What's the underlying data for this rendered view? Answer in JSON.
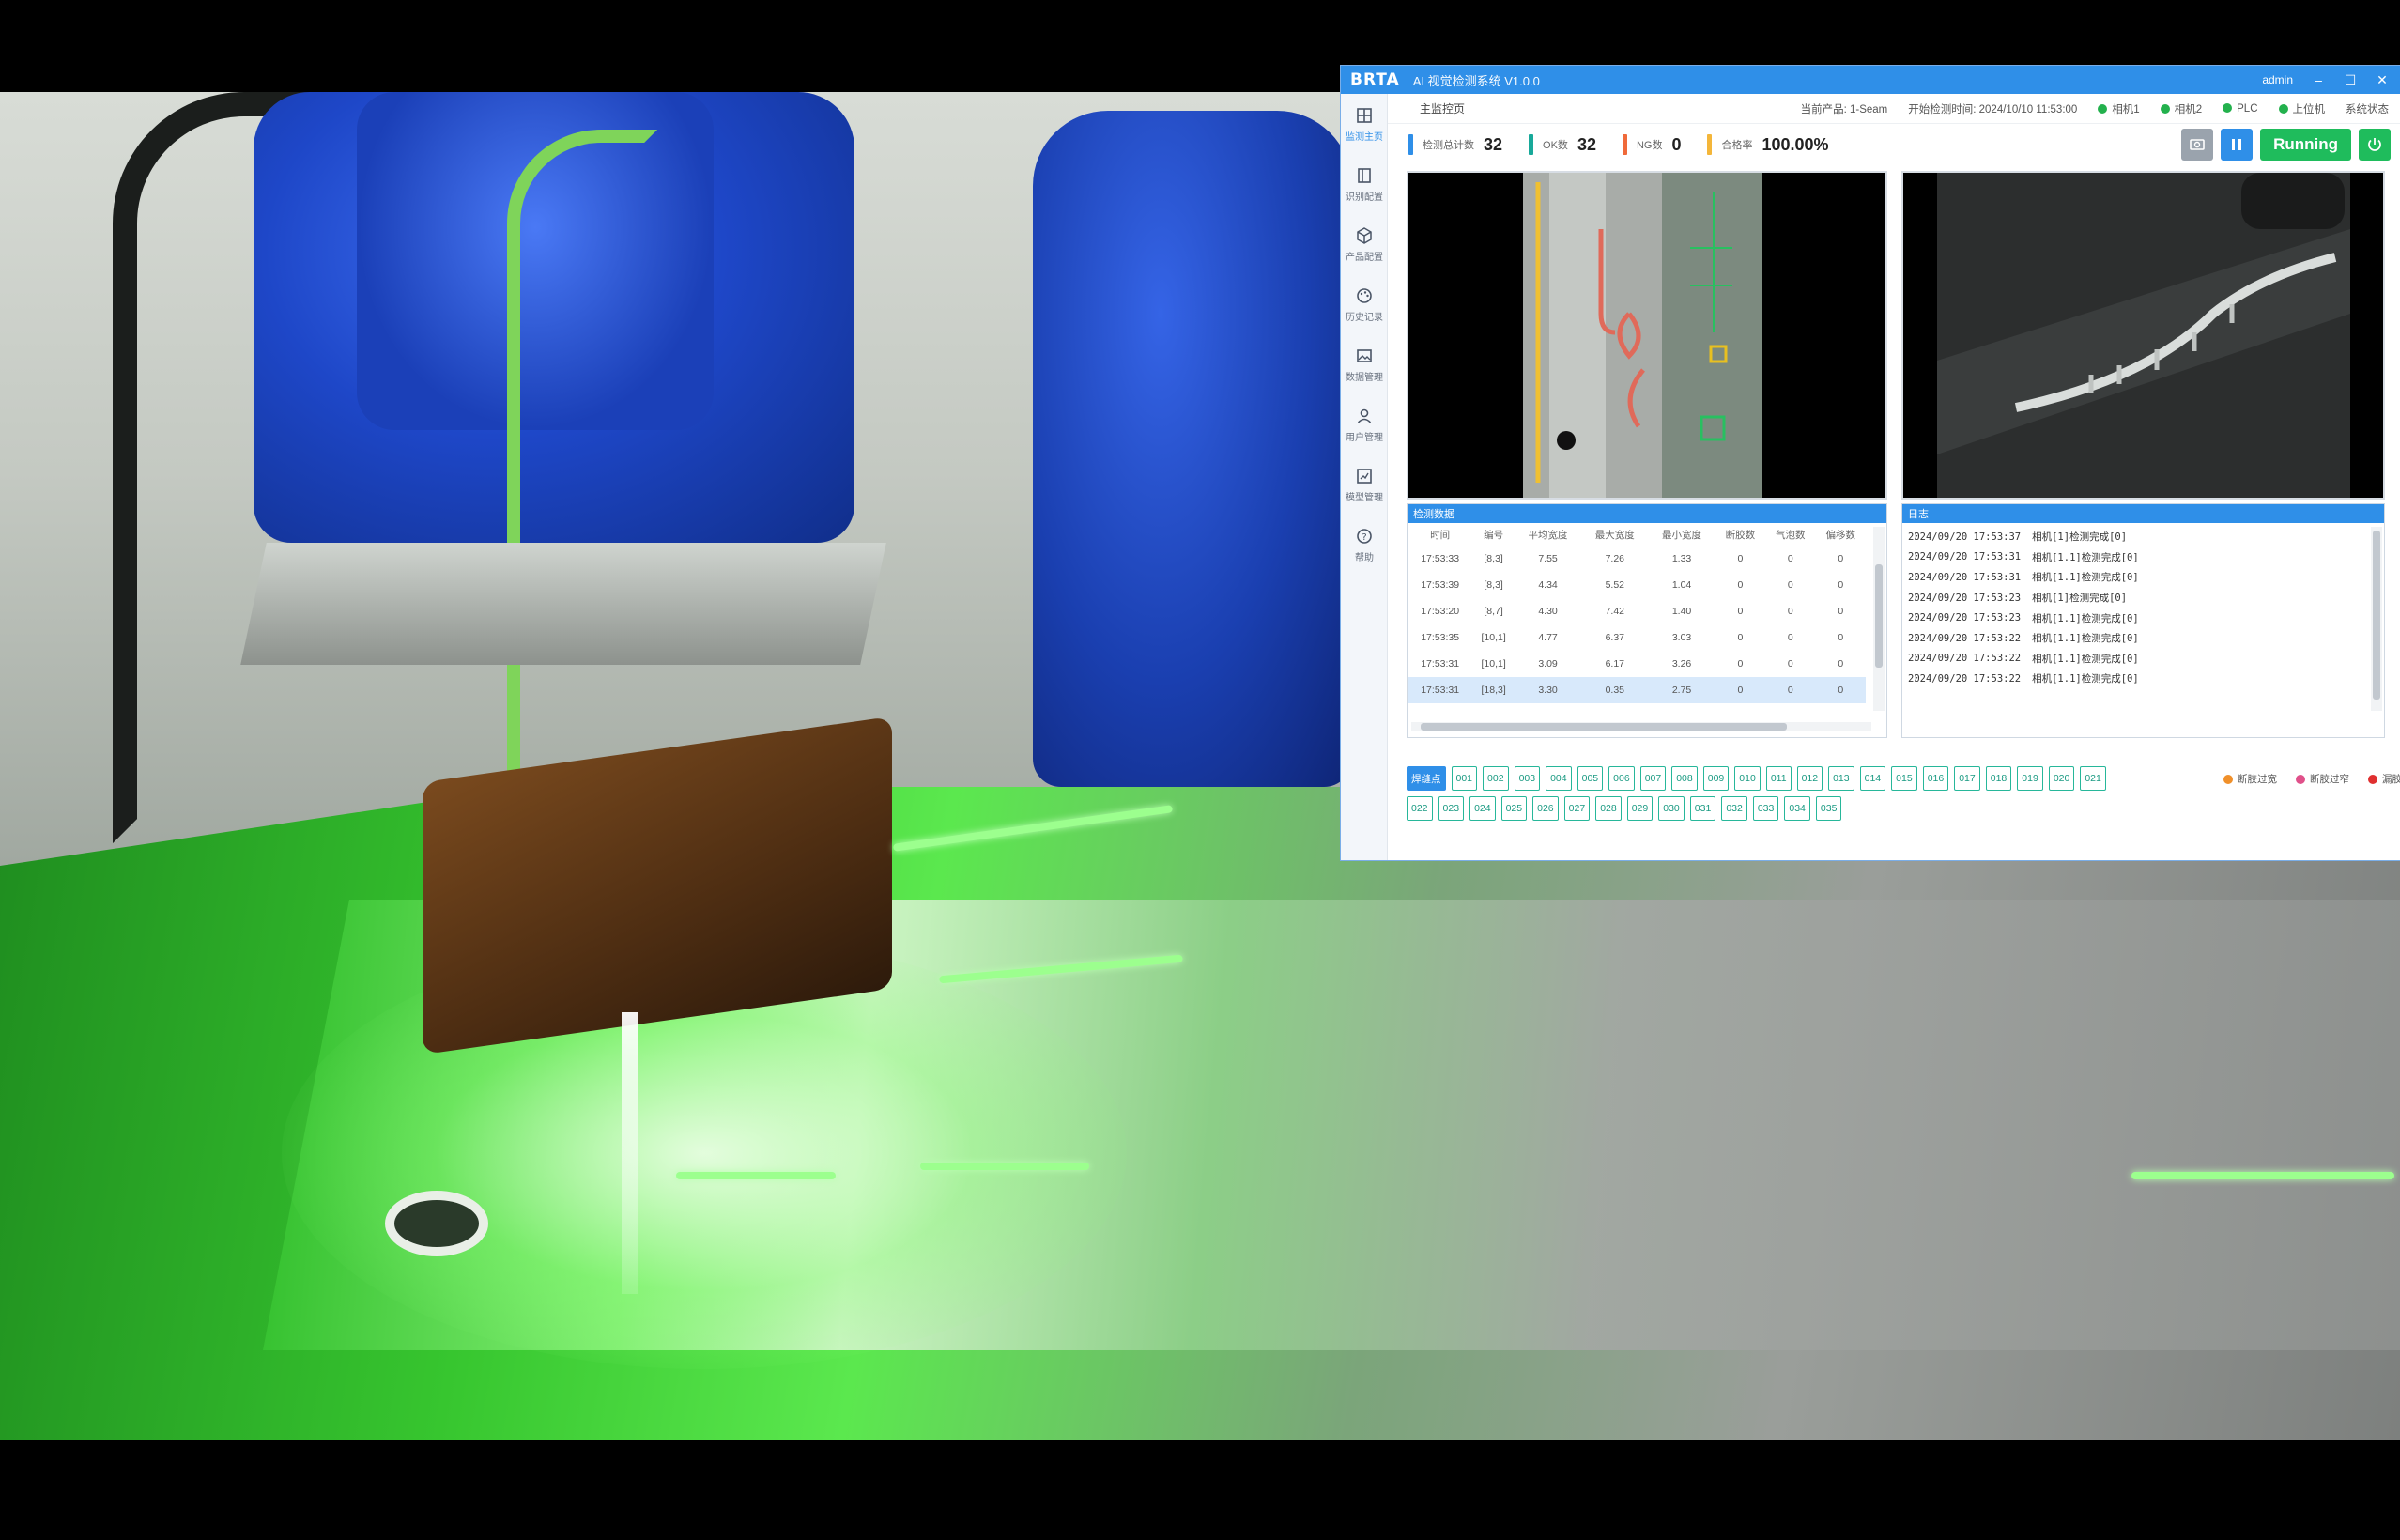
{
  "window": {
    "logo": "BRTA",
    "title": "AI 视觉检测系统 V1.0.0",
    "user": "admin",
    "colors": {
      "accent": "#2f8fe8",
      "run": "#1fbc5c"
    }
  },
  "sidebar": {
    "items": [
      {
        "label": "监测主页",
        "icon": "grid-icon"
      },
      {
        "label": "识别配置",
        "icon": "layout-icon"
      },
      {
        "label": "产品配置",
        "icon": "box-icon"
      },
      {
        "label": "历史记录",
        "icon": "palette-icon"
      },
      {
        "label": "数据管理",
        "icon": "image-icon"
      },
      {
        "label": "用户管理",
        "icon": "user-icon"
      },
      {
        "label": "模型管理",
        "icon": "chart-icon"
      },
      {
        "label": "帮助",
        "icon": "help-icon"
      }
    ]
  },
  "infobar": {
    "page_title": "主监控页",
    "product": "当前产品: 1-Seam",
    "start_time": "开始检测时间: 2024/10/10 11:53:00",
    "status_items": [
      "相机1",
      "相机2",
      "PLC",
      "上位机"
    ],
    "extra": "系统状态"
  },
  "stats": [
    {
      "label": "检测总计数",
      "value": "32",
      "color": "#2f8fe8"
    },
    {
      "label": "OK数",
      "value": "32",
      "color": "#18a99a"
    },
    {
      "label": "NG数",
      "value": "0",
      "color": "#f06a3a"
    },
    {
      "label": "合格率",
      "value": "100.00%",
      "color": "#f4b63a"
    }
  ],
  "controls": {
    "run_label": "Running"
  },
  "table": {
    "title": "检测数据",
    "headers": [
      "时间",
      "编号",
      "平均宽度",
      "最大宽度",
      "最小宽度",
      "断胶数",
      "气泡数",
      "偏移数"
    ],
    "rows": [
      [
        "17:53:33",
        "[8,3]",
        "7.55",
        "7.26",
        "1.33",
        "0",
        "0",
        "0"
      ],
      [
        "17:53:39",
        "[8,3]",
        "4.34",
        "5.52",
        "1.04",
        "0",
        "0",
        "0"
      ],
      [
        "17:53:20",
        "[8,7]",
        "4.30",
        "7.42",
        "1.40",
        "0",
        "0",
        "0"
      ],
      [
        "17:53:35",
        "[10,1]",
        "4.77",
        "6.37",
        "3.03",
        "0",
        "0",
        "0"
      ],
      [
        "17:53:31",
        "[10,1]",
        "3.09",
        "6.17",
        "3.26",
        "0",
        "0",
        "0"
      ],
      [
        "17:53:31",
        "[18,3]",
        "3.30",
        "0.35",
        "2.75",
        "0",
        "0",
        "0"
      ]
    ],
    "selected_row": 5
  },
  "log": {
    "title": "日志",
    "lines": [
      {
        "time": "2024/09/20 17:53:37",
        "msg": "相机[1]检测完成[0]"
      },
      {
        "time": "2024/09/20 17:53:31",
        "msg": "相机[1.1]检测完成[0]"
      },
      {
        "time": "2024/09/20 17:53:31",
        "msg": "相机[1.1]检测完成[0]"
      },
      {
        "time": "2024/09/20 17:53:23",
        "msg": "相机[1]检测完成[0]"
      },
      {
        "time": "2024/09/20 17:53:23",
        "msg": "相机[1.1]检测完成[0]"
      },
      {
        "time": "2024/09/20 17:53:22",
        "msg": "相机[1.1]检测完成[0]"
      },
      {
        "time": "2024/09/20 17:53:22",
        "msg": "相机[1.1]检测完成[0]"
      },
      {
        "time": "2024/09/20 17:53:22",
        "msg": "相机[1.1]检测完成[0]"
      }
    ]
  },
  "chips": {
    "row1": [
      "焊缝点",
      "001",
      "002",
      "003",
      "004",
      "005",
      "006",
      "007",
      "008",
      "009",
      "010",
      "011",
      "012",
      "013",
      "014",
      "015",
      "016",
      "017",
      "018",
      "019",
      "020",
      "021"
    ],
    "row2": [
      "022",
      "023",
      "024",
      "025",
      "026",
      "027",
      "028",
      "029",
      "030",
      "031",
      "032",
      "033",
      "034",
      "035"
    ],
    "legend": [
      {
        "label": "断胶过宽",
        "color": "#f0902a"
      },
      {
        "label": "断胶过窄",
        "color": "#e0508a"
      },
      {
        "label": "漏胶",
        "color": "#e03030"
      }
    ]
  }
}
